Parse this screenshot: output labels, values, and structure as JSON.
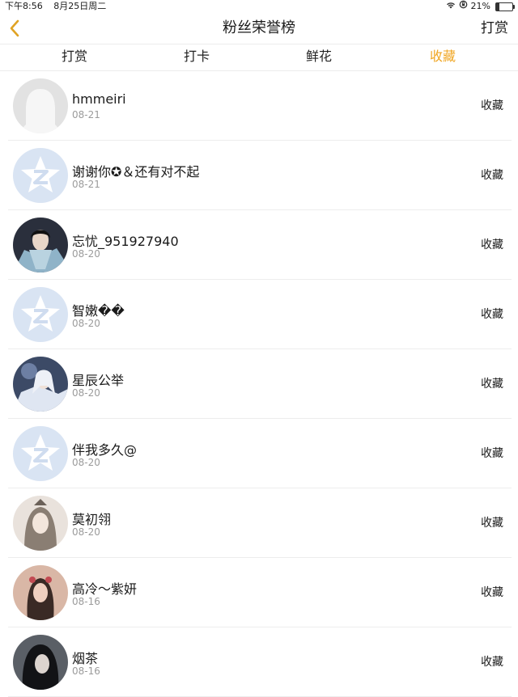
{
  "status_bar": {
    "time": "下午8:56",
    "date": "8月25日周二",
    "battery": "21%",
    "battery_level": 0.21
  },
  "nav": {
    "title": "粉丝荣誉榜",
    "action": "打赏"
  },
  "tabs": [
    {
      "label": "打赏",
      "active": false
    },
    {
      "label": "打卡",
      "active": false
    },
    {
      "label": "鲜花",
      "active": false
    },
    {
      "label": "收藏",
      "active": true
    }
  ],
  "colors": {
    "accent": "#f0a623",
    "secondary_text": "#9b9b9b",
    "divider": "#ededed"
  },
  "list": [
    {
      "name": "hmmeiri",
      "date": "08-21",
      "action": "收藏",
      "avatar": "default-silhouette-icon"
    },
    {
      "name": "谢谢你✪＆还有对不起",
      "date": "08-21",
      "action": "收藏",
      "avatar": "default-z-icon"
    },
    {
      "name": "忘忧_951927940",
      "date": "08-20",
      "action": "收藏",
      "avatar": "photo"
    },
    {
      "name": "智嫩��",
      "date": "08-20",
      "action": "收藏",
      "avatar": "default-z-icon"
    },
    {
      "name": "星辰公举",
      "date": "08-20",
      "action": "收藏",
      "avatar": "photo"
    },
    {
      "name": "伴我多久@",
      "date": "08-20",
      "action": "收藏",
      "avatar": "default-z-icon"
    },
    {
      "name": "莫初翎",
      "date": "08-20",
      "action": "收藏",
      "avatar": "photo"
    },
    {
      "name": "高冷～紫妍",
      "date": "08-16",
      "action": "收藏",
      "avatar": "photo"
    },
    {
      "name": "烟茶",
      "date": "08-16",
      "action": "收藏",
      "avatar": "photo"
    }
  ]
}
